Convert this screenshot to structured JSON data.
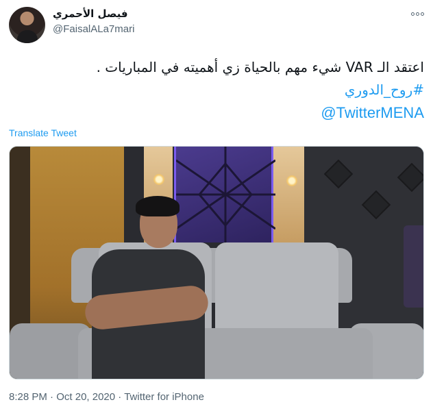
{
  "user": {
    "display_name": "فيصل الأحمري",
    "handle": "@FaisalALa7mari",
    "avatar_icon": "user-avatar"
  },
  "more_icon": "more-options-icon",
  "tweet": {
    "text_line": "اعتقد الـ VAR شيء مهم بالحياة زي أهميته في المباريات .",
    "hashtag": "#روح_الدوري",
    "mention": "@TwitterMENA"
  },
  "translate_label": "Translate Tweet",
  "media": {
    "type": "photo",
    "description_icon": "tweet-image"
  },
  "meta": {
    "time": "8:28 PM",
    "separator": " · ",
    "date": "Oct 20, 2020",
    "source": "Twitter for iPhone"
  },
  "colors": {
    "link": "#1d9bf0",
    "secondary_text": "#536471",
    "primary_text": "#0f1419"
  }
}
